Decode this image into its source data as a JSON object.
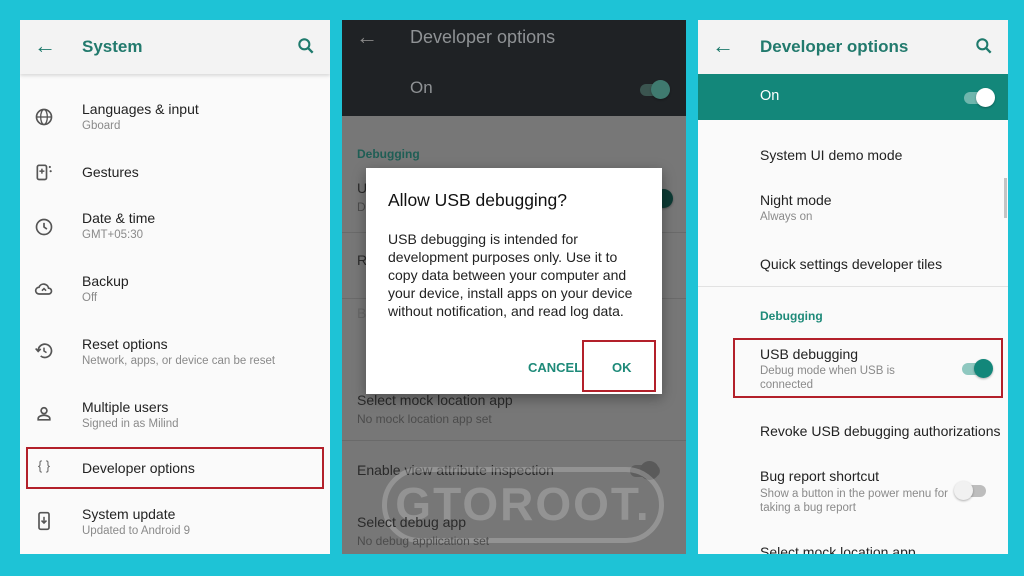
{
  "panel1": {
    "title": "System",
    "items": [
      {
        "icon": "globe-icon",
        "title": "Languages & input",
        "subtitle": "Gboard"
      },
      {
        "icon": "gestures-icon",
        "title": "Gestures",
        "subtitle": ""
      },
      {
        "icon": "clock-icon",
        "title": "Date & time",
        "subtitle": "GMT+05:30"
      },
      {
        "icon": "cloud-upload-icon",
        "title": "Backup",
        "subtitle": "Off"
      },
      {
        "icon": "restore-icon",
        "title": "Reset options",
        "subtitle": "Network, apps, or device can be reset"
      },
      {
        "icon": "person-icon",
        "title": "Multiple users",
        "subtitle": "Signed in as Milind"
      },
      {
        "icon": "braces-icon",
        "title": "Developer options",
        "subtitle": ""
      },
      {
        "icon": "system-update-icon",
        "title": "System update",
        "subtitle": "Updated to Android 9"
      }
    ]
  },
  "panel2": {
    "title": "Developer options",
    "master_switch_label": "On",
    "master_switch_on": true,
    "section": "Debugging",
    "bg_rows": [
      {
        "title": "U",
        "subtitle": "D"
      },
      {
        "title": "R",
        "subtitle": ""
      },
      {
        "title": "B",
        "subtitle": "S"
      }
    ],
    "rows": [
      {
        "title": "Select mock location app",
        "subtitle": "No mock location app set"
      },
      {
        "title": "Enable view attribute inspection",
        "subtitle": ""
      },
      {
        "title": "Select debug app",
        "subtitle": "No debug application set"
      }
    ],
    "dialog": {
      "title": "Allow USB debugging?",
      "body": "USB debugging is intended for development purposes only. Use it to copy data between your computer and your device, install apps on your device without notification, and read log data.",
      "cancel_label": "CANCEL",
      "ok_label": "OK"
    },
    "watermark": "GTOROOT."
  },
  "panel3": {
    "title": "Developer options",
    "master_switch_label": "On",
    "master_switch_on": true,
    "items_top": [
      {
        "title": "System UI demo mode",
        "subtitle": ""
      },
      {
        "title": "Night mode",
        "subtitle": "Always on"
      },
      {
        "title": "Quick settings developer tiles",
        "subtitle": ""
      }
    ],
    "section": "Debugging",
    "usb_debugging": {
      "title": "USB debugging",
      "subtitle": "Debug mode when USB is connected",
      "on": true
    },
    "revoke": {
      "title": "Revoke USB debugging authorizations"
    },
    "bug_report": {
      "title": "Bug report shortcut",
      "subtitle": "Show a button in the power menu for taking a bug report",
      "on": false
    },
    "mock_location": {
      "title": "Select mock location app"
    }
  },
  "colors": {
    "background": "#1ec3d6",
    "accent": "#13877a",
    "highlight_box": "#b3202a"
  }
}
